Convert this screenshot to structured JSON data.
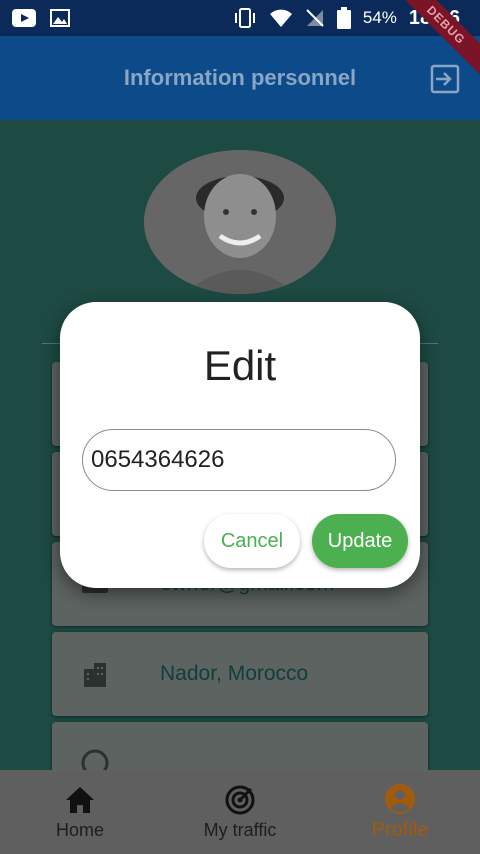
{
  "status_bar": {
    "battery": "54%",
    "time": "18:06"
  },
  "debug_banner": "DEBUG",
  "app_bar": {
    "title": "Information personnel"
  },
  "cards": [
    {
      "icon": "phone-icon",
      "text": ""
    },
    {
      "icon": "person-icon",
      "text": ""
    },
    {
      "icon": "email-icon",
      "text": "owner@gmail.com"
    },
    {
      "icon": "city-icon",
      "text": "Nador, Morocco"
    },
    {
      "icon": "info-icon",
      "text": ""
    }
  ],
  "dialog": {
    "title": "Edit",
    "input_value": "0654364626",
    "cancel_label": "Cancel",
    "update_label": "Update"
  },
  "bottom_nav": {
    "items": [
      {
        "label": "Home",
        "icon": "home-icon"
      },
      {
        "label": "My traffic",
        "icon": "radar-icon"
      },
      {
        "label": "Profile",
        "icon": "account-circle-icon"
      }
    ],
    "active_index": 2
  },
  "colors": {
    "app_bar": "#0c4a8a",
    "accent_green": "#4caf50",
    "active_nav": "#a25a0e"
  }
}
